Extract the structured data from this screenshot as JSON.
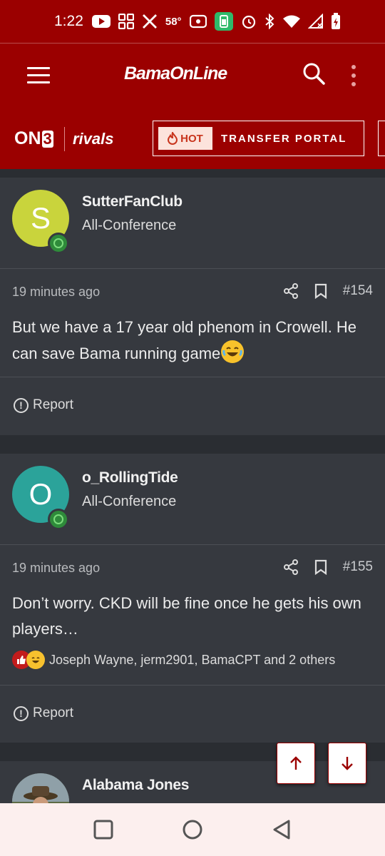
{
  "status_bar": {
    "time": "1:22",
    "temperature": "58°",
    "icons": [
      "youtube-icon",
      "widgets-icon",
      "x-icon",
      "radio-icon",
      "battery-saver-icon",
      "alarm-icon",
      "bluetooth-icon",
      "wifi-icon",
      "signal-icon",
      "battery-icon"
    ]
  },
  "header": {
    "brand": "BamaOnLine",
    "menu_icon": "hamburger-icon",
    "search_icon": "search-icon",
    "more_icon": "kebab-icon"
  },
  "subheader": {
    "on3_label": "ON",
    "on3_digit": "3",
    "rivals_label": "rivals",
    "hot_badge": "HOT",
    "portal_label": "TRANSFER PORTAL"
  },
  "posts": [
    {
      "avatar_letter": "S",
      "avatar_color": "#c9d43c",
      "username": "SutterFanClub",
      "rank": "All-Conference",
      "time": "19 minutes ago",
      "post_number": "#154",
      "message": "But we have a 17 year old phenom in Crowell. He can save Bama running game",
      "report_label": "Report"
    },
    {
      "avatar_letter": "O",
      "avatar_color": "#2ba39a",
      "username": "o_RollingTide",
      "rank": "All-Conference",
      "time": "19 minutes ago",
      "post_number": "#155",
      "message": "Don’t worry. CKD will be fine once he gets his own players…",
      "reactions": "Joseph Wayne, jerm2901, BamaCPT and 2 others",
      "report_label": "Report"
    },
    {
      "username": "Alabama Jones"
    }
  ],
  "colors": {
    "brand_red": "#9b0000",
    "post_bg": "#36393f",
    "page_bg": "#2a2d32",
    "nav_bg": "#fcefee"
  }
}
